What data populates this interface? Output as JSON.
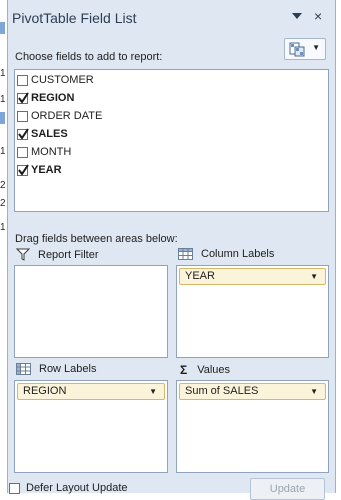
{
  "window": {
    "title": "PivotTable Field List"
  },
  "header": {
    "dropdown_icon": "chevron-down-icon",
    "close_label": "×"
  },
  "field_section": {
    "label": "Choose fields to add to report:"
  },
  "fields": [
    {
      "name": "CUSTOMER",
      "checked": false
    },
    {
      "name": "REGION",
      "checked": true
    },
    {
      "name": "ORDER DATE",
      "checked": false
    },
    {
      "name": "SALES",
      "checked": true
    },
    {
      "name": "MONTH",
      "checked": false
    },
    {
      "name": "YEAR",
      "checked": true
    }
  ],
  "areas_section": {
    "label": "Drag fields between areas below:"
  },
  "areas": {
    "report_filter": {
      "label": "Report Filter"
    },
    "column_labels": {
      "label": "Column Labels",
      "item": "YEAR"
    },
    "row_labels": {
      "label": "Row Labels",
      "item": "REGION"
    },
    "values": {
      "label": "Values",
      "symbol": "Σ",
      "item": "Sum of SALES"
    }
  },
  "footer": {
    "defer_label": "Defer Layout Update",
    "update_label": "Update"
  },
  "edge_marks": [
    "1",
    "1",
    "1",
    "2",
    "2",
    "1"
  ],
  "colors": {
    "chip_bg": "#fcf4da",
    "panel_bg": "#dfe7f2"
  }
}
